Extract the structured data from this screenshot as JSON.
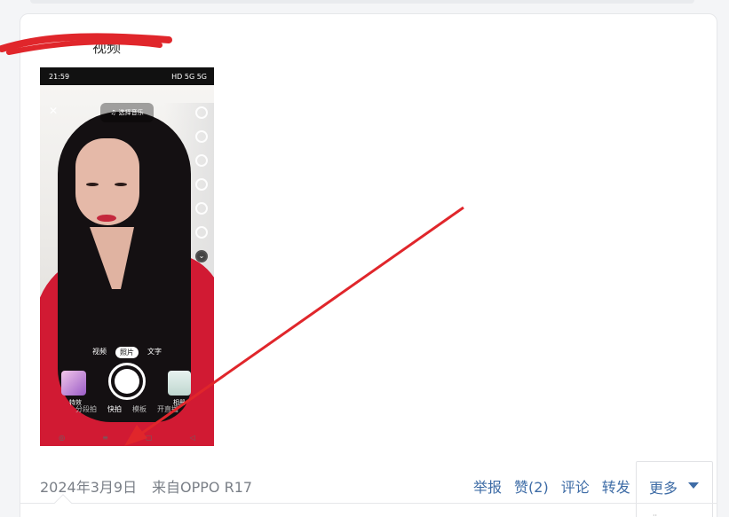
{
  "post": {
    "caption": "视频",
    "date": "2024年3月9日",
    "source": "来自OPPO R17"
  },
  "phone_ui": {
    "status_time": "21:59",
    "status_signal": "HD 5G 5G",
    "music_button": "选择音乐",
    "modes": [
      "视频",
      "照片",
      "文字"
    ],
    "active_mode": "照片",
    "effects_label": "特效",
    "album_label": "相册",
    "bottom_tabs": [
      "分段拍",
      "快拍",
      "模板",
      "开直播"
    ],
    "current_tab": "快拍"
  },
  "actions": {
    "report": "举报",
    "like": "赞(2)",
    "comment": "评论",
    "repost": "转发",
    "more": "更多"
  },
  "colors": {
    "link": "#3e6ca6",
    "meta": "#7a7f87",
    "annotation_red": "#e0262b"
  }
}
